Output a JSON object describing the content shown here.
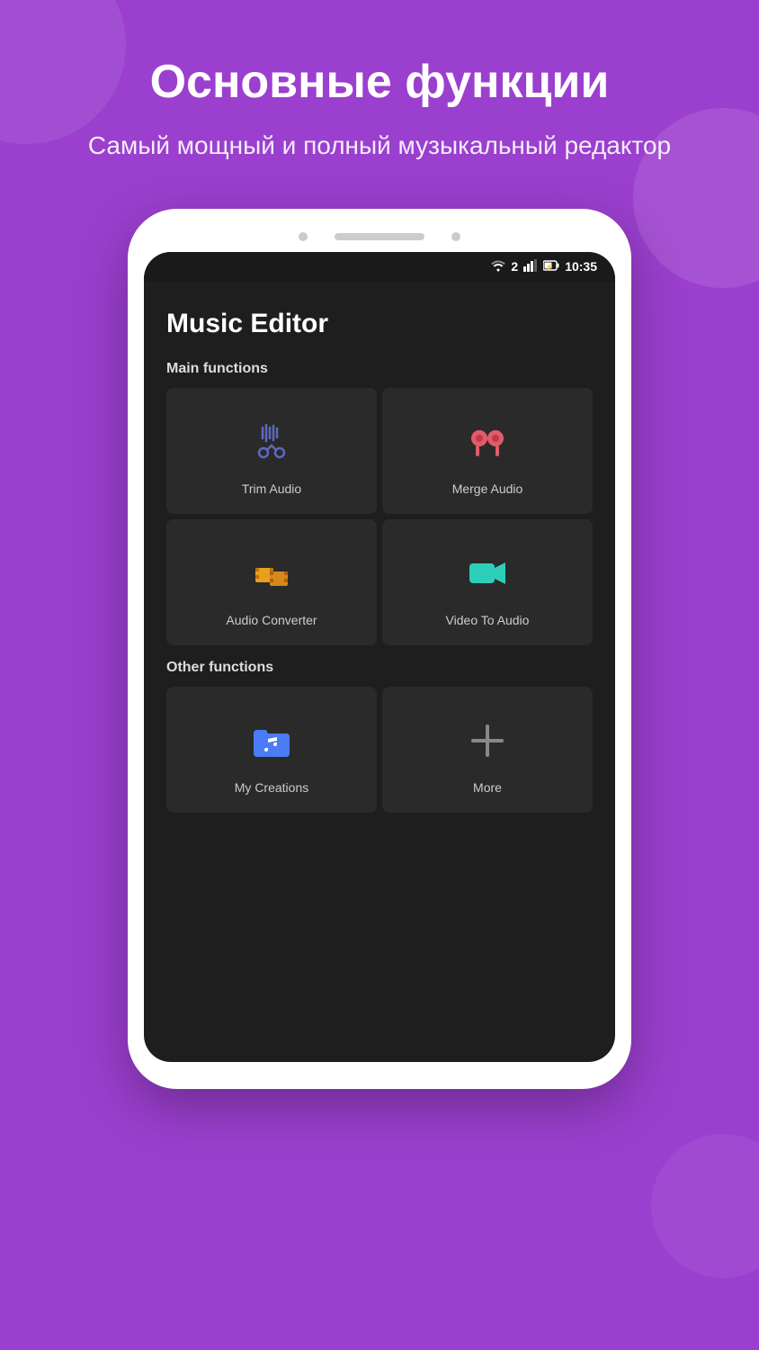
{
  "background_color": "#9b3fcf",
  "header": {
    "title": "Основные функции",
    "subtitle": "Самый мощный и полный музыкальный редактор"
  },
  "phone": {
    "status_bar": {
      "time": "10:35",
      "sim": "2"
    },
    "app_title": "Music Editor",
    "sections": [
      {
        "label": "Main functions",
        "items": [
          {
            "id": "trim-audio",
            "label": "Trim Audio",
            "icon": "scissors"
          },
          {
            "id": "merge-audio",
            "label": "Merge Audio",
            "icon": "headphones"
          },
          {
            "id": "audio-converter",
            "label": "Audio Converter",
            "icon": "film"
          },
          {
            "id": "video-to-audio",
            "label": "Video To Audio",
            "icon": "video"
          }
        ]
      },
      {
        "label": "Other functions",
        "items": [
          {
            "id": "my-creations",
            "label": "My Creations",
            "icon": "music-folder"
          },
          {
            "id": "more",
            "label": "More",
            "icon": "plus"
          }
        ]
      }
    ]
  }
}
